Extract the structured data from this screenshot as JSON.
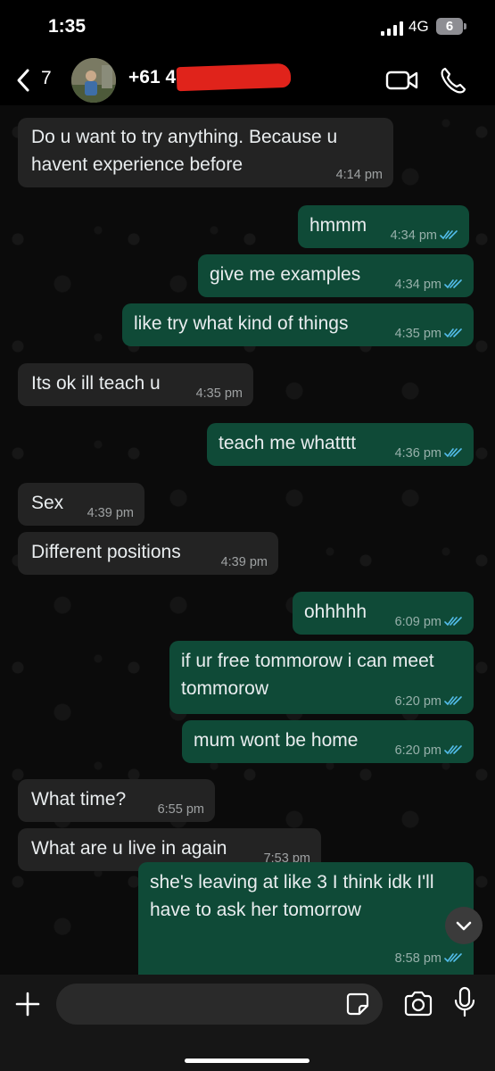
{
  "status_bar": {
    "time": "1:35",
    "network": "4G",
    "battery": "6"
  },
  "header": {
    "back_count": "7",
    "contact_name": "+61 4"
  },
  "messages": [
    {
      "dir": "in",
      "text": "Do u want to try anything. Because u havent experience before",
      "time": "4:14 pm"
    },
    {
      "dir": "out",
      "text": "hmmm",
      "time": "4:34 pm"
    },
    {
      "dir": "out",
      "text": "give me examples",
      "time": "4:34 pm"
    },
    {
      "dir": "out",
      "text": "like try what kind of things",
      "time": "4:35 pm"
    },
    {
      "dir": "in",
      "text": "Its ok ill teach u",
      "time": "4:35 pm"
    },
    {
      "dir": "out",
      "text": "teach me whatttt",
      "time": "4:36 pm"
    },
    {
      "dir": "in",
      "text": "Sex",
      "time": "4:39 pm"
    },
    {
      "dir": "in",
      "text": "Different positions",
      "time": "4:39 pm"
    },
    {
      "dir": "out",
      "text": "ohhhhh",
      "time": "6:09 pm"
    },
    {
      "dir": "out",
      "text": "if ur free tommorow i can meet tommorow",
      "time": "6:20 pm"
    },
    {
      "dir": "out",
      "text": "mum wont be home",
      "time": "6:20 pm"
    },
    {
      "dir": "in",
      "text": "What time?",
      "time": "6:55 pm"
    },
    {
      "dir": "in",
      "text": "What are u live in again",
      "time": "7:53 pm"
    },
    {
      "dir": "out",
      "text": "she's leaving at like 3 I think idk I'll have to ask her tomorrow",
      "time": "8:58 pm"
    }
  ],
  "composer": {
    "placeholder": ""
  },
  "colors": {
    "incoming_bubble": "#232323",
    "outgoing_bubble": "#0f4a37",
    "read_ticks": "#53bdeb",
    "redaction": "#e0231b"
  }
}
